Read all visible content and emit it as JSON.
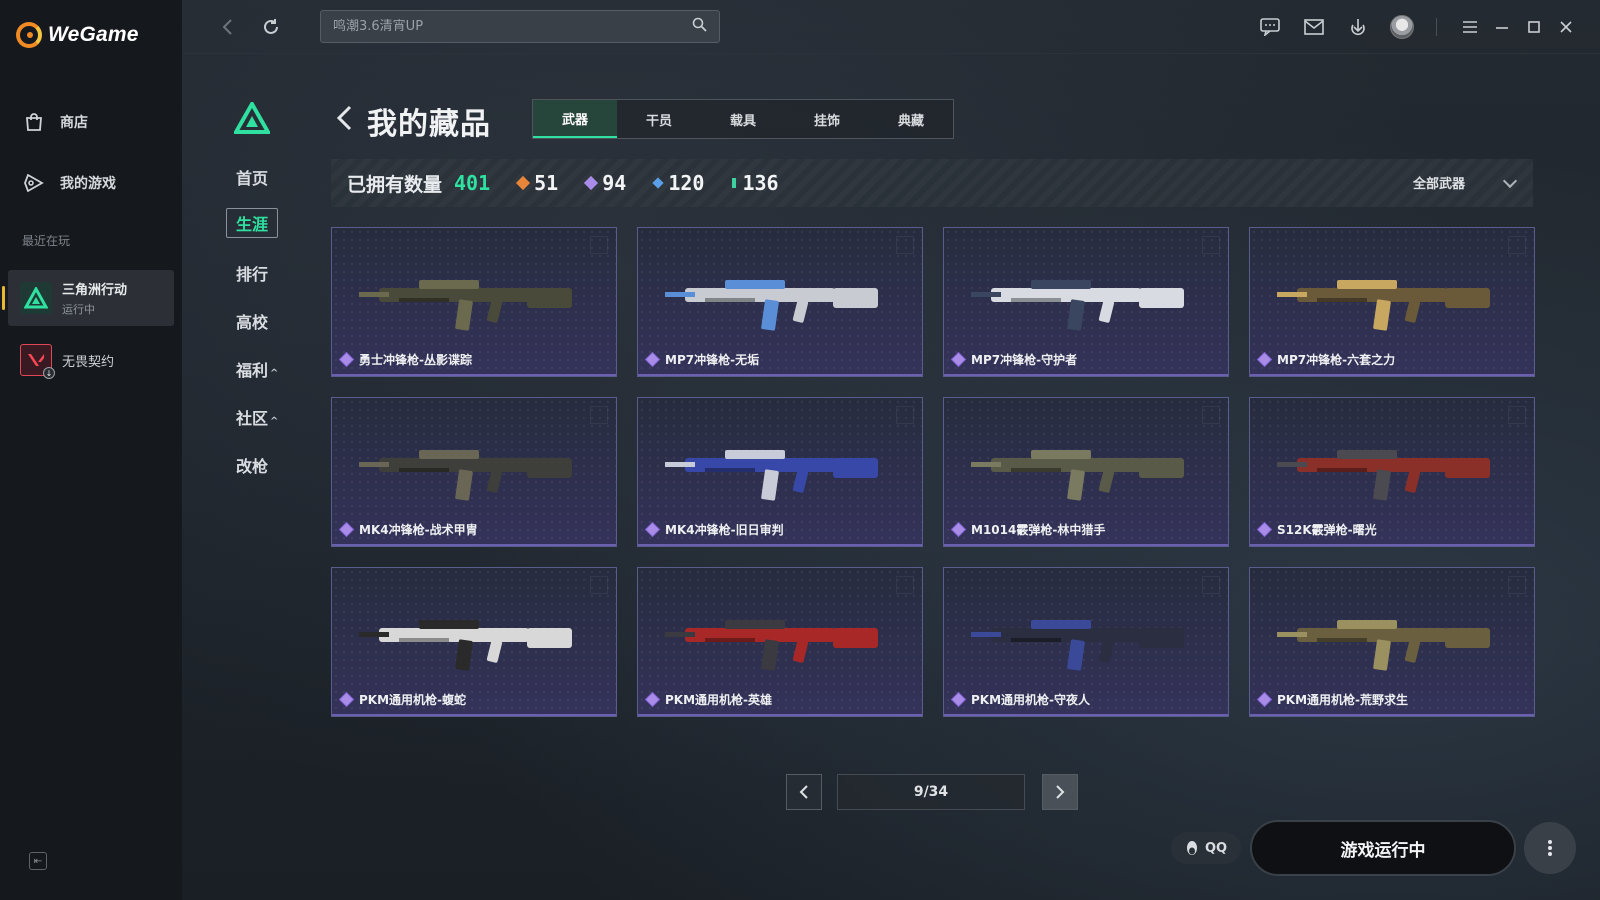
{
  "app": {
    "brand": "WeGame"
  },
  "sidebar": {
    "items": [
      {
        "label": "商店",
        "icon": "bag-icon"
      },
      {
        "label": "我的游戏",
        "icon": "gamepad-icon"
      }
    ],
    "recent_label": "最近在玩",
    "recent_games": [
      {
        "name": "三角洲行动",
        "status": "运行中",
        "active": true
      },
      {
        "name": "无畏契约",
        "status": "",
        "active": false
      }
    ]
  },
  "topbar": {
    "search_placeholder": "鸣潮3.6清宵UP"
  },
  "game_nav": {
    "items": [
      {
        "label": "首页",
        "active": false,
        "caret": ""
      },
      {
        "label": "生涯",
        "active": true,
        "caret": ""
      },
      {
        "label": "排行",
        "active": false,
        "caret": ""
      },
      {
        "label": "高校",
        "active": false,
        "caret": ""
      },
      {
        "label": "福利",
        "active": false,
        "caret": "^"
      },
      {
        "label": "社区",
        "active": false,
        "caret": "^"
      },
      {
        "label": "改枪",
        "active": false,
        "caret": ""
      }
    ]
  },
  "header": {
    "title": "我的藏品",
    "tabs": [
      {
        "label": "武器",
        "active": true
      },
      {
        "label": "干员",
        "active": false
      },
      {
        "label": "载具",
        "active": false
      },
      {
        "label": "挂饰",
        "active": false
      },
      {
        "label": "典藏",
        "active": false
      }
    ]
  },
  "stats": {
    "owned_label": "已拥有数量",
    "owned_count": "401",
    "rarities": [
      {
        "value": "51",
        "color": "#e8853a"
      },
      {
        "value": "94",
        "color": "#a98be8"
      },
      {
        "value": "120",
        "color": "#5aa0e8"
      },
      {
        "value": "136",
        "color": "#3fd0a0"
      }
    ],
    "filter_label": "全部武器"
  },
  "colors": {
    "accent": "#2fe0a0",
    "card_rarity": "#a98be8"
  },
  "items": [
    {
      "name": "勇士冲锋枪-丛影谍踪",
      "tone": [
        "#4a4a3a",
        "#6b6a4e"
      ]
    },
    {
      "name": "MP7冲锋枪-无垢",
      "tone": [
        "#c8ccd2",
        "#5a8fd8"
      ]
    },
    {
      "name": "MP7冲锋枪-守护者",
      "tone": [
        "#d8dce2",
        "#3a4560"
      ]
    },
    {
      "name": "MP7冲锋枪-六套之力",
      "tone": [
        "#6b5a3a",
        "#c8a860"
      ]
    },
    {
      "name": "MK4冲锋枪-战术甲胄",
      "tone": [
        "#3e3e3a",
        "#6a6656"
      ]
    },
    {
      "name": "MK4冲锋枪-旧日审判",
      "tone": [
        "#3848a8",
        "#c8ccd8"
      ]
    },
    {
      "name": "M1014霰弹枪-林中猎手",
      "tone": [
        "#5a5a48",
        "#7a7a60"
      ]
    },
    {
      "name": "S12K霰弹枪-曙光",
      "tone": [
        "#8a3028",
        "#4a4a50"
      ]
    },
    {
      "name": "PKM通用机枪-蝮蛇",
      "tone": [
        "#d8d8d8",
        "#2a2a2a"
      ]
    },
    {
      "name": "PKM通用机枪-英雄",
      "tone": [
        "#a82828",
        "#3a3a40"
      ]
    },
    {
      "name": "PKM通用机枪-守夜人",
      "tone": [
        "#2a2e40",
        "#3a4a98"
      ]
    },
    {
      "name": "PKM通用机枪-荒野求生",
      "tone": [
        "#6a6040",
        "#9a9060"
      ]
    }
  ],
  "pager": {
    "current": "9/34"
  },
  "bottom": {
    "qq_label": "QQ",
    "launch_label": "游戏运行中"
  }
}
